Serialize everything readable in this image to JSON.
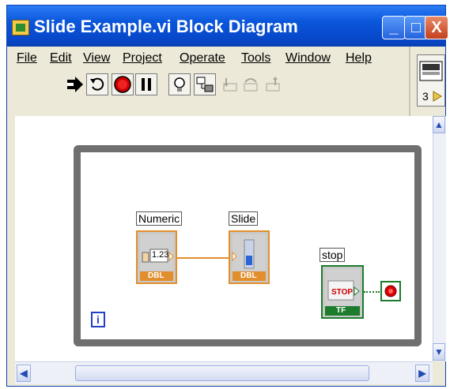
{
  "window": {
    "title": "Slide Example.vi Block Diagram",
    "minimize_label": "_",
    "maximize_label": "□",
    "close_label": "X"
  },
  "menu": [
    "File",
    "Edit",
    "View",
    "Project",
    "Operate",
    "Tools",
    "Window",
    "Help"
  ],
  "menu_underline_index": [
    0,
    0,
    0,
    0,
    0,
    0,
    0,
    0
  ],
  "toolbar": {
    "tools": [
      "run-arrow",
      "run-continuously",
      "abort-stop",
      "pause",
      "highlight-execution",
      "step-into",
      "step-over",
      "step-out",
      "retain-wire-values"
    ]
  },
  "context_help": {
    "number": "3"
  },
  "diagram": {
    "numeric_label": "Numeric",
    "numeric_value": "1.23",
    "numeric_type": "DBL",
    "slide_label": "Slide",
    "slide_type": "DBL",
    "stop_label": "stop",
    "stop_text": "STOP",
    "stop_type": "TF",
    "iteration_label": "i"
  },
  "colors": {
    "title_bar": "#0a56db",
    "dbl_wire": "#e38e2c",
    "boolean_wire": "#1c7c2c",
    "loop_frame": "#6f6f6f",
    "iteration_terminal": "#2240c8"
  },
  "scrollbar": {
    "vertical_up": "▲",
    "vertical_down": "▼",
    "horizontal_left": "◀",
    "horizontal_right": "▶"
  }
}
